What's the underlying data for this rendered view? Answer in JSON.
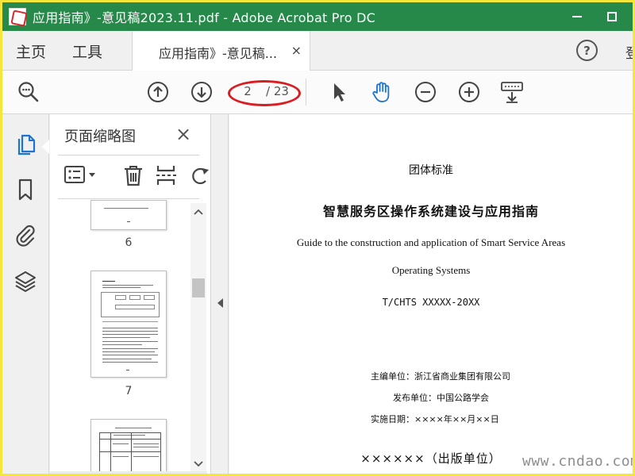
{
  "window": {
    "title": "应用指南》-意见稿2023.11.pdf - Adobe Acrobat Pro DC",
    "icons": {
      "app": "acrobat-app-icon",
      "minimize": "minimize-icon",
      "maximize": "maximize-icon"
    }
  },
  "menu": {
    "home": "主页",
    "tools": "工具",
    "doc_tab": "应用指南》-意见稿...",
    "doc_tab_close": "×",
    "help": "?",
    "cut_label": "登"
  },
  "toolbar": {
    "current_page": "2",
    "total_pages": "/ 23",
    "icons": [
      "search-icon",
      "page-up-icon",
      "page-down-icon",
      "select-pointer-icon",
      "hand-tool-icon",
      "zoom-out-icon",
      "zoom-in-icon",
      "keyboard-scroll-icon"
    ],
    "accent": "#1b74d1",
    "annotation_color": "#d91e22"
  },
  "rail": {
    "icons": [
      "page-thumbnails-icon",
      "bookmark-icon",
      "attachment-icon",
      "layers-icon"
    ],
    "active_color": "#1b74d1"
  },
  "thumbnails": {
    "title": "页面缩略图",
    "close": "×",
    "tool_icons": [
      "options-menu-icon",
      "delete-page-icon",
      "insert-page-icon",
      "rotate-page-icon"
    ],
    "pages": [
      {
        "label": "6"
      },
      {
        "label": "7"
      }
    ]
  },
  "document": {
    "standard_type": "团体标准",
    "title_cn": "智慧服务区操作系统建设与应用指南",
    "title_en_1": "Guide to the construction and application of Smart Service Areas",
    "title_en_2": "Operating Systems",
    "code": "T/CHTS XXXXX-20XX",
    "editor": "主编单位：浙江省商业集团有限公司",
    "issuer": "发布单位：中国公路学会",
    "date": "实施日期：××××年××月××日",
    "publisher": "××××××（出版单位）"
  },
  "watermark": "www.cndao.com",
  "colors": {
    "titlebar": "#26894a",
    "frame": "#f5e63a"
  }
}
